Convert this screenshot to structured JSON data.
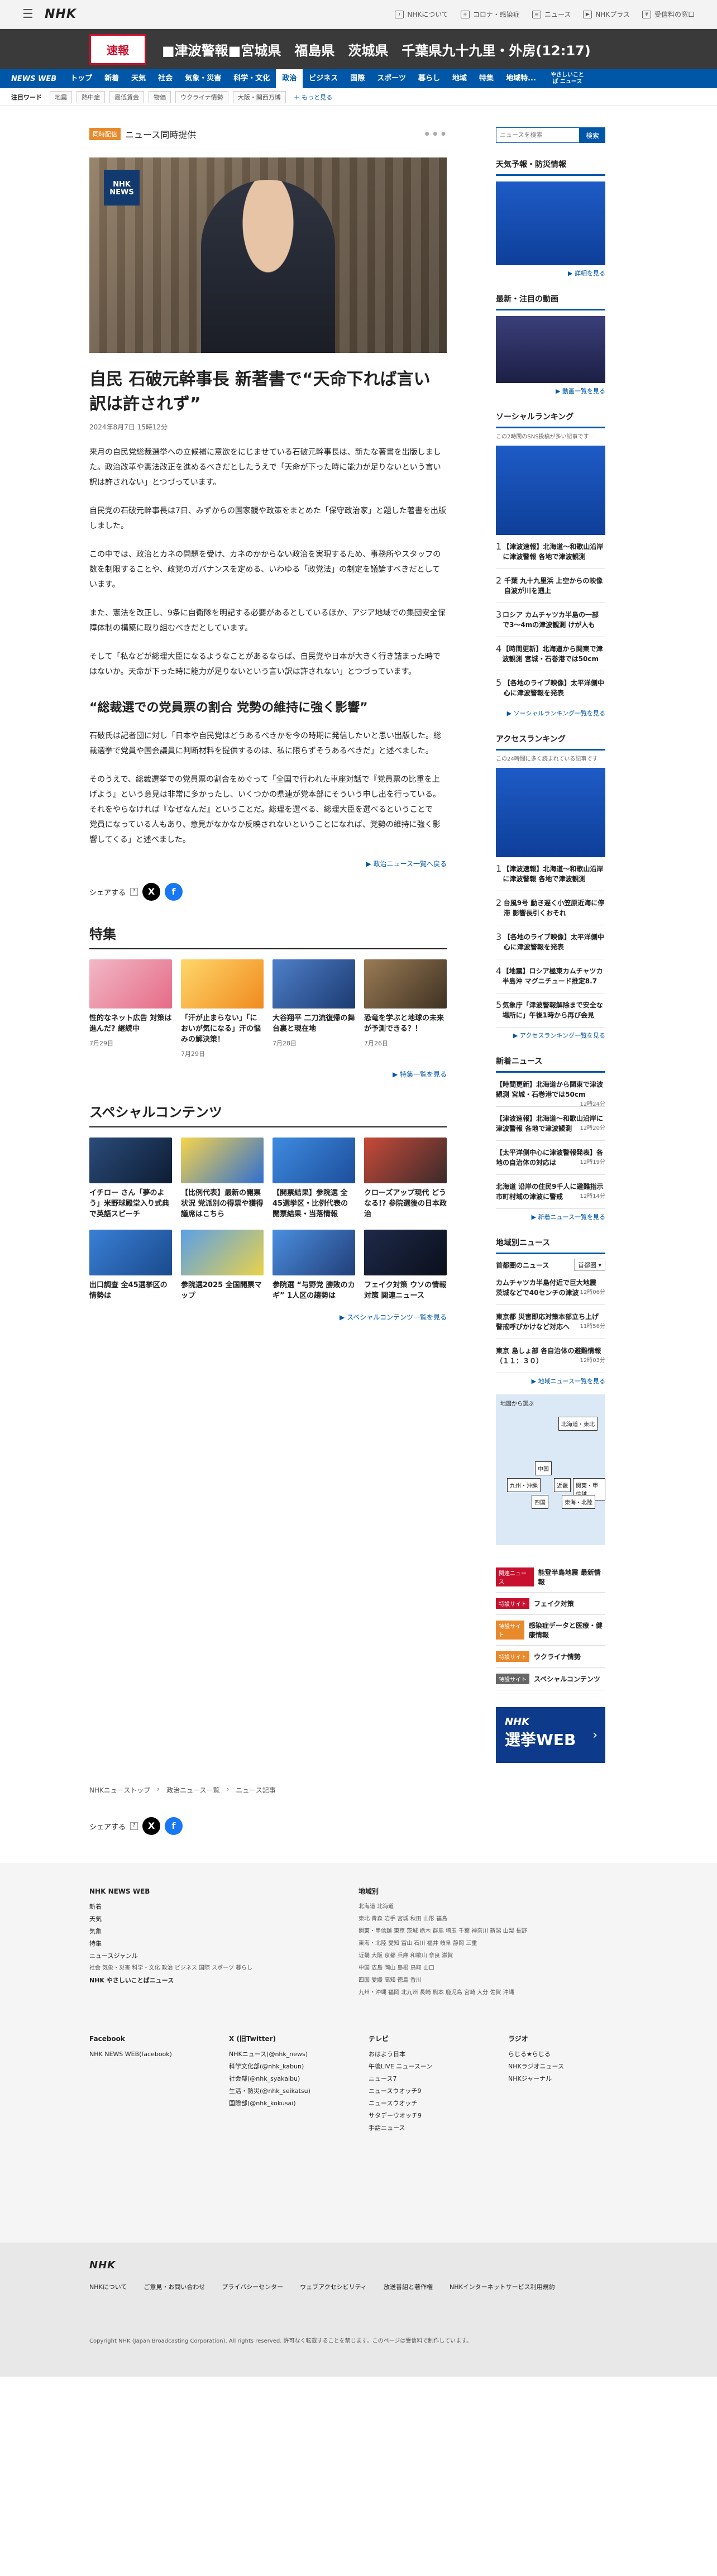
{
  "header": {
    "logo": "NHK",
    "links": [
      "NHKについて",
      "コロナ・感染症",
      "ニュース",
      "NHKプラス",
      "受信料の窓口"
    ]
  },
  "alert": {
    "badge": "速報",
    "text": "■津波警報■宮城県　福島県　茨城県　千葉県九十九里・外房(12:17)"
  },
  "nav": {
    "brand": "NEWS WEB",
    "items": [
      "トップ",
      "新着",
      "天気",
      "社会",
      "気象・災害",
      "科学・文化",
      "政治",
      "ビジネス",
      "国際",
      "スポーツ",
      "暮らし",
      "地域",
      "特集",
      "地域特..."
    ],
    "easy": "やさしいことば ニュース"
  },
  "tags": {
    "label": "注目ワード",
    "items": [
      "地震",
      "熱中症",
      "最低賃金",
      "物価",
      "ウクライナ情勢",
      "大阪・関西万博"
    ],
    "more": "もっと見る"
  },
  "article": {
    "badge": "同時配信",
    "kicker": "ニュース同時提供",
    "hero_logo": "NHK NEWS",
    "title": "自民 石破元幹事長 新著書で“天命下れば言い訳は許されず”",
    "date": "2024年8月7日 15時12分",
    "paras": [
      "来月の自民党総裁選挙への立候補に意欲をにじませている石破元幹事長は、新たな著書を出版しました。政治改革や憲法改正を進めるべきだとしたうえで「天命が下った時に能力が足りないという言い訳は許されない」とつづっています。",
      "自民党の石破元幹事長は7日、みずからの国家観や政策をまとめた「保守政治家」と題した著書を出版しました。",
      "この中では、政治とカネの問題を受け、カネのかからない政治を実現するため、事務所やスタッフの数を制限することや、政党のガバナンスを定める、いわゆる「政党法」の制定を議論すべきだとしています。",
      "また、憲法を改正し、9条に自衛隊を明記する必要があるとしているほか、アジア地域での集団安全保障体制の構築に取り組むべきだとしています。",
      "そして「私などが総理大臣になるようなことがあるならば、自民党や日本が大きく行き詰まった時ではないか。天命が下った時に能力が足りないという言い訳は許されない」とつづっています。"
    ],
    "subhead": "“総裁選での党員票の割合 党勢の維持に強く影響”",
    "paras2": [
      "石破氏は記者団に対し「日本や自民党はどうあるべきかを今の時期に発信したいと思い出版した。総裁選挙で党員や国会議員に判断材料を提供するのは、私に限らずそうあるべきだ」と述べました。",
      "そのうえで、総裁選挙での党員票の割合をめぐって「全国で行われた車座対話で『党員票の比重を上げよう』という意見は非常に多かったし、いくつかの県連が党本部にそういう申し出を行っている。それをやらなければ『なぜなんだ』ということだ。総理を選べる、総理大臣を選べるということで　党員になっている人もあり、意見がなかなか反映されないということになれば、党勢の維持に強く影響してくる」と述べました。"
    ],
    "more": "政治ニュース一覧へ戻る",
    "share": "シェアする"
  },
  "feature": {
    "title": "特集",
    "more": "特集一覧を見る",
    "cards": [
      {
        "t": "性的なネット広告 対策は進んだ? 継続中",
        "d": "7月29日"
      },
      {
        "t": "「汗が止まらない」「においが気になる」汗の悩みの解決策！",
        "d": "7月29日"
      },
      {
        "t": "大谷翔平 二刀流復帰の舞台裏と現在地",
        "d": "7月28日"
      },
      {
        "t": "恐竜を学ぶと地球の未来が予測できる？！",
        "d": "7月26日"
      }
    ]
  },
  "special": {
    "title": "スペシャルコンテンツ",
    "more": "スペシャルコンテンツ一覧を見る",
    "cards": [
      "イチロー さん「夢のよう」米野球殿堂入り式典で英語スピーチ",
      "【比例代表】最新の開票状況 党派別の得票や獲得議席はこちら",
      "【開票結果】参院選 全45選挙区・比例代表の開票結果・当落情報",
      "クローズアップ現代 どうなる!? 参院選後の日本政治",
      "出口調査 全45選挙区の情勢は",
      "参院選2025 全国開票マップ",
      "参院選 “与野党 勝敗のカギ” 1人区の趨勢は",
      "フェイク対策 ウソの情報対策 関連ニュース"
    ]
  },
  "breadcrumb": [
    "NHKニューストップ",
    "政治ニュース一覧",
    "ニュース記事"
  ],
  "side": {
    "search_placeholder": "ニュースを検索",
    "search_btn": "検索",
    "weather": {
      "title": "天気予報・防災情報",
      "more": "詳細を見る"
    },
    "video": {
      "title": "最新・注目の動画",
      "more": "動画一覧を見る"
    },
    "social": {
      "title": "ソーシャルランキング",
      "note": "この2時間のSNS投稿が多い記事です",
      "items": [
        "【津波速報】北海道〜和歌山沿岸に津波警報 各地で津波観測",
        "千葉 九十九里浜 上空からの映像 自波が川を遡上",
        "ロシア カムチャツカ半島の一部で3〜4mの津波観測 けが人も",
        "【時間更新】北海道から関東で津波観測 宮城・石巻港では50cm",
        "【各地のライブ映像】太平洋側中心に津波警報を発表"
      ],
      "more": "ソーシャルランキング一覧を見る"
    },
    "access": {
      "title": "アクセスランキング",
      "note": "この24時間に多く読まれている記事です",
      "items": [
        "【津波速報】北海道〜和歌山沿岸に津波警報 各地で津波観測",
        "台風9号 動き遅く小笠原近海に停滞 影響長引くおそれ",
        "【各地のライブ映像】太平洋側中心に津波警報を発表",
        "【地震】ロシア極東カムチャツカ半島沖 マグニチュード推定8.7",
        "気象庁「津波警報解除まで安全な場所に」午後1時から再び会見"
      ],
      "more": "アクセスランキング一覧を見る"
    },
    "latest": {
      "title": "新着ニュース",
      "items": [
        {
          "t": "【時間更新】北海道から関東で津波観測 宮城・石巻港では50cm",
          "d": "12時24分"
        },
        {
          "t": "【津波速報】北海道〜和歌山沿岸に津波警報 各地で津波観測",
          "d": "12時20分"
        },
        {
          "t": "【太平洋側中心に津波警報発表】各地の自治体の対応は",
          "d": "12時19分"
        },
        {
          "t": "北海道 沿岸の住民9千人に避難指示 市町村域の津波に警戒",
          "d": "12時14分"
        }
      ],
      "more": "新着ニュース一覧を見る"
    },
    "local": {
      "title": "地域別ニュース",
      "label": "首都圏のニュース",
      "select": "首都圏",
      "items": [
        {
          "t": "カムチャツカ半島付近で巨大地震 茨城などで40センチの津波",
          "d": "12時06分"
        },
        {
          "t": "東京都 災害即応対策本部立ち上げ 警戒呼びかけなど対応へ",
          "d": "11時56分"
        },
        {
          "t": "東京 島しょ部 各自治体の避難情報（１１：３０）",
          "d": "12時03分"
        }
      ],
      "more": "地域ニュース一覧を見る"
    },
    "region_map": {
      "label": "地図から選ぶ",
      "regions": [
        "北海道・東北",
        "中国",
        "近畿",
        "関東・甲信越",
        "九州・沖縄",
        "四国",
        "東海・北陸"
      ]
    },
    "banners": [
      {
        "b": "関連ニュース",
        "t": "能登半島地震 最新情報"
      },
      {
        "b": "特設サイト",
        "t": "フェイク対策"
      },
      {
        "b": "特設サイト",
        "t": "感染症データと医療・健康情報"
      },
      {
        "b": "特設サイト",
        "t": "ウクライナ情勢"
      },
      {
        "b": "特設サイト",
        "t": "スペシャルコンテンツ"
      }
    ],
    "election": {
      "logo": "NHK",
      "text": "選挙WEB"
    }
  },
  "footer": {
    "brand": "NHK NEWS WEB",
    "cols1": [
      "新着",
      "天気",
      "気象",
      "特集",
      "ニュースジャンル",
      "社会 気象・災害 科学・文化 政治 ビジネス 国際 スポーツ 暮らし",
      "NHK やさしいことばニュース"
    ],
    "region_title": "地域別",
    "regions": [
      "北海道 北海道",
      "東北 青森 岩手 宮城 秋田 山形 福島",
      "関東・甲信越 東京 茨城 栃木 群馬 埼玉 千葉 神奈川 新潟 山梨 長野",
      "東海・北陸 愛知 富山 石川 福井 岐阜 静岡 三重",
      "近畿 大阪 京都 兵庫 和歌山 奈良 滋賀",
      "中国 広島 岡山 島根 鳥取 山口",
      "四国 愛媛 高知 徳島 香川",
      "九州・沖縄 福岡 北九州 長崎 熊本 鹿児島 宮崎 大分 佐賀 沖縄"
    ],
    "fb_title": "Facebook",
    "fb": "NHK NEWS WEB(facebook)",
    "x_title": "X (旧Twitter)",
    "x": [
      "NHKニュース(@nhk_news)",
      "科学文化部(@nhk_kabun)",
      "社会部(@nhk_syakaibu)",
      "生活・防災(@nhk_seikatsu)",
      "国際部(@nhk_kokusai)"
    ],
    "tv_title": "テレビ",
    "tv": [
      "おはよう日本",
      "午後LIVE ニュースーン",
      "ニュース7",
      "ニュースウオッチ9",
      "ニュースウオッチ",
      "サタデーウオッチ9",
      "手話ニュース"
    ],
    "radio_title": "ラジオ",
    "radio": [
      "らじる★らじる",
      "NHKラジオニュース",
      "NHKジャーナル"
    ],
    "bottom_links": [
      "NHKについて",
      "ご意見・お問い合わせ",
      "プライバシーセンター",
      "ウェブアクセシビリティ",
      "放送番組と著作権",
      "NHKインターネットサービス利用規約"
    ],
    "copyright": "Copyright NHK (Japan Broadcasting Corporation). All rights reserved. 許可なく転載することを禁じます。このページは受信料で制作しています。"
  }
}
